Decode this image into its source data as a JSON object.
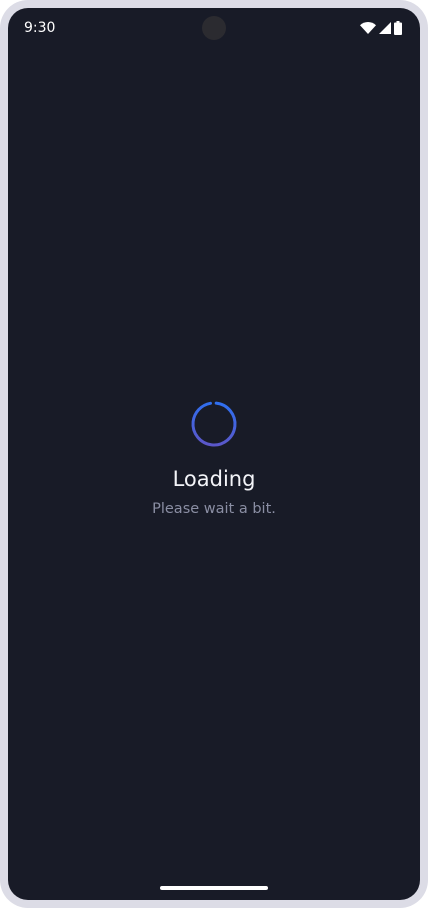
{
  "status_bar": {
    "time": "9:30",
    "icons": [
      "wifi-icon",
      "cellular-signal-icon",
      "battery-icon"
    ]
  },
  "loading": {
    "title": "Loading",
    "subtitle": "Please wait a bit.",
    "spinner_colors": [
      "#5b57c9",
      "#2f6ff0"
    ]
  },
  "colors": {
    "background": "#181b27",
    "frame": "#dcdce6",
    "title": "#f3f4f8",
    "subtitle": "#8a8ea3"
  }
}
